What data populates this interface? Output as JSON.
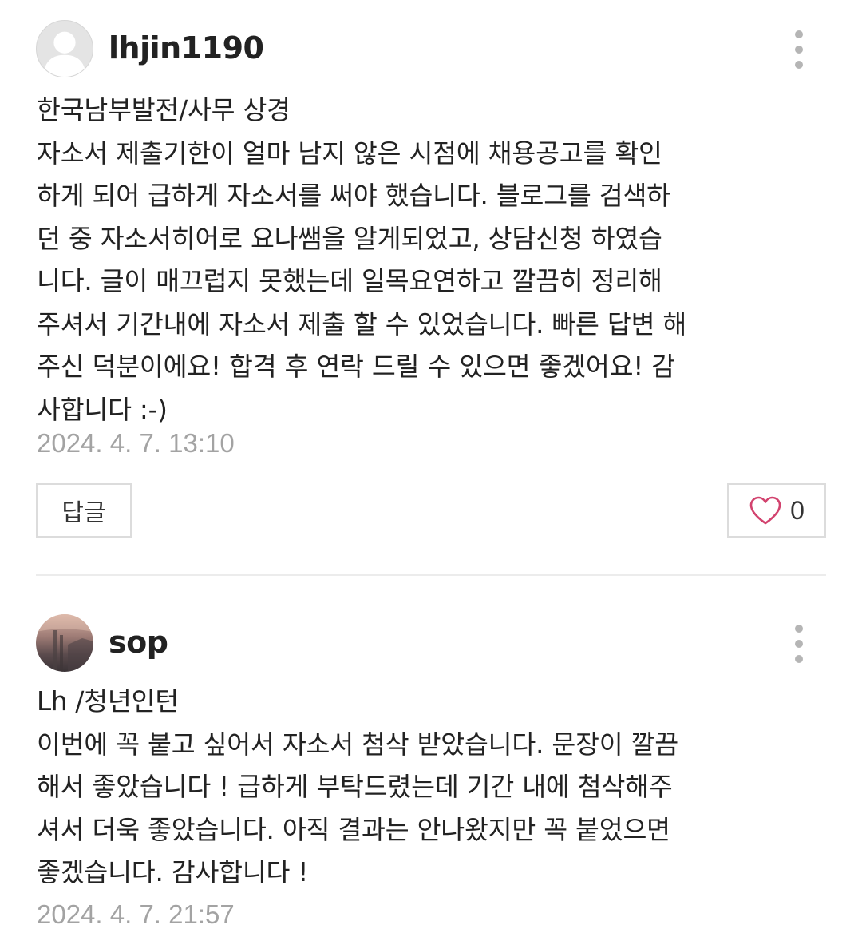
{
  "comments": [
    {
      "username": "lhjin1190",
      "lines": [
        "한국남부발전/사무 상경",
        "자소서 제출기한이 얼마 남지 않은 시점에 채용공고를 확인",
        "하게 되어 급하게 자소서를 써야 했습니다. 블로그를 검색하",
        "던 중 자소서히어로 요나쌤을 알게되었고, 상담신청 하였습",
        "니다. 글이 매끄럽지 못했는데 일목요연하고 깔끔히 정리해",
        "주셔서 기간내에 자소서 제출 할 수 있었습니다. 빠른 답변 해",
        "주신 덕분이에요! 합격 후 연락 드릴 수 있으면 좋겠어요! 감",
        "사합니다 :-)"
      ],
      "timestamp": "2024. 4. 7. 13:10",
      "reply_label": "답글",
      "like_count": "0",
      "avatar": "default-avatar-icon"
    },
    {
      "username": "sop",
      "lines": [
        "Lh /청년인턴",
        "이번에 꼭 붙고 싶어서 자소서 첨삭 받았습니다. 문장이 깔끔",
        "해서 좋았습니다 ! 급하게 부탁드렸는데 기간 내에 첨삭해주",
        "셔서 더욱 좋았습니다. 아직 결과는 안나왔지만 꼭 붙었으면",
        "좋겠습니다. 감사합니다 !"
      ],
      "timestamp": "2024. 4. 7. 21:57",
      "avatar": "profile-photo"
    }
  ],
  "colors": {
    "text": "#222222",
    "timestamp": "#a3a3a3",
    "border": "#dcdcdc",
    "heart": "#d2426e",
    "divider": "#ececec"
  },
  "icons": {
    "more": "more-vertical-icon",
    "like": "heart-icon"
  }
}
